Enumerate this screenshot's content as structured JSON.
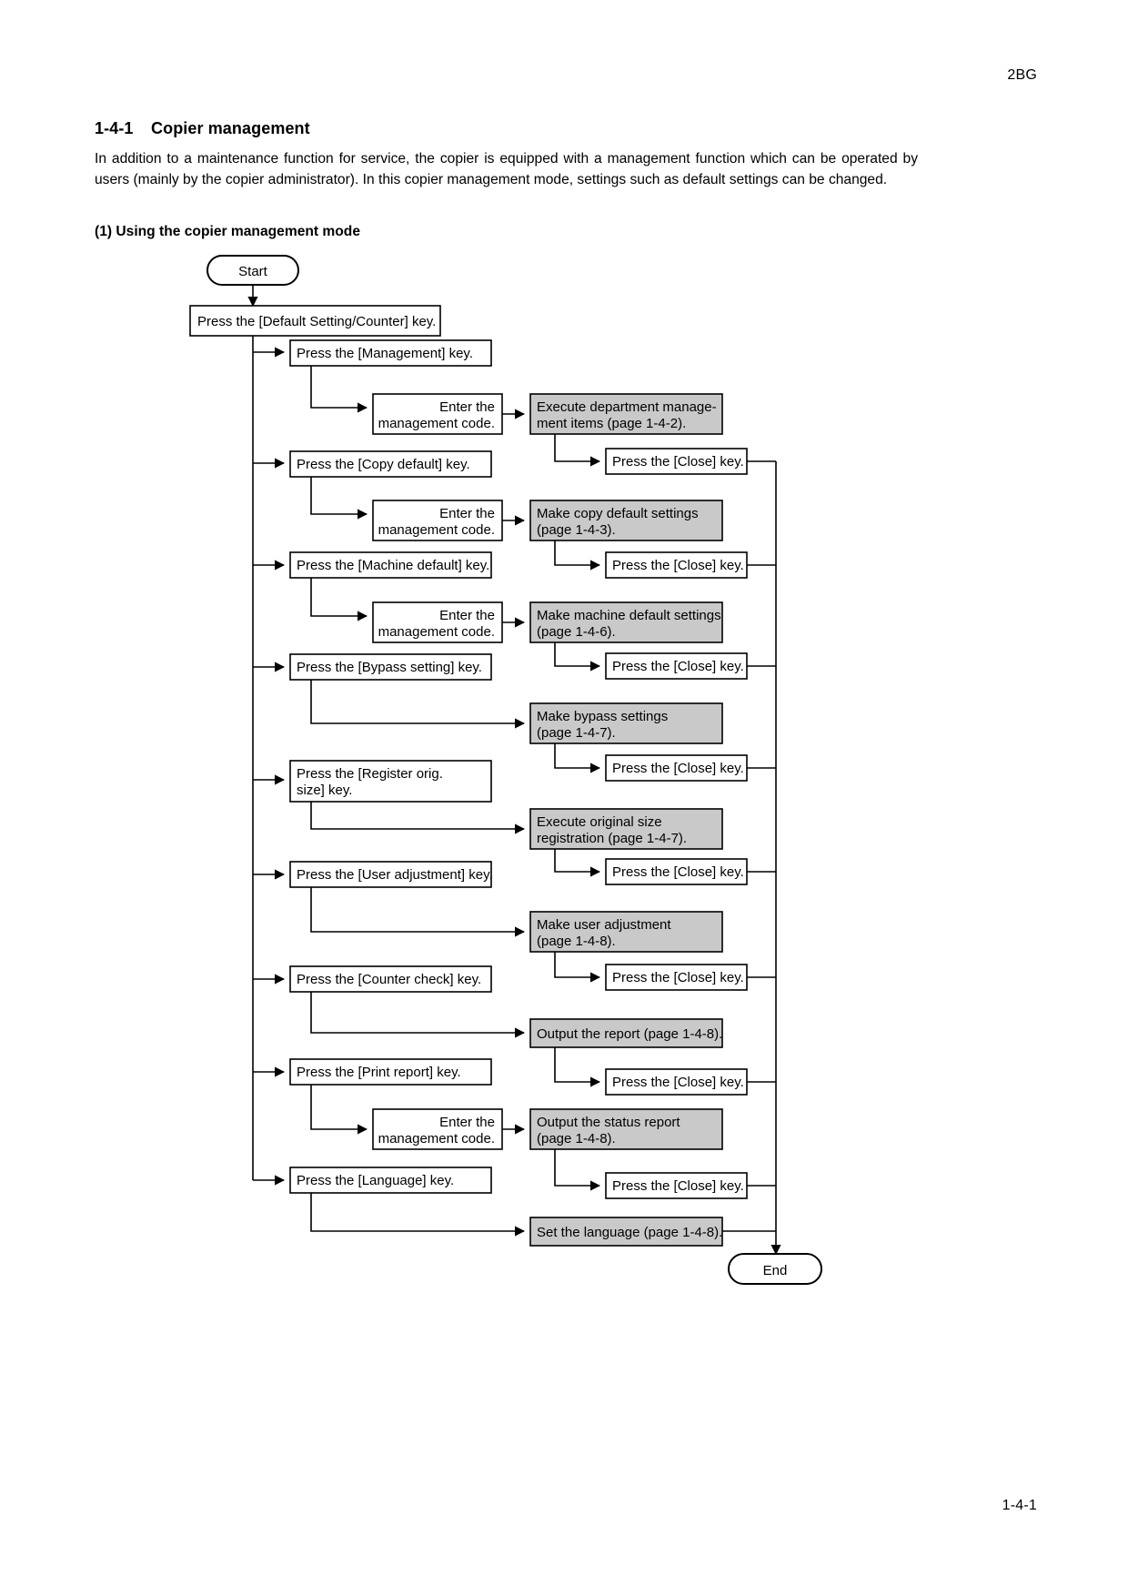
{
  "document": {
    "code": "2BG",
    "page_number": "1-4-1"
  },
  "section": {
    "number": "1-4-1",
    "title": "Copier management",
    "body": "In addition to a maintenance function for service, the copier is equipped with a management function which can be operated by users (mainly by the copier administrator). In this copier management mode, settings such as default settings can be changed.",
    "subsection_title": "(1) Using the copier management mode"
  },
  "flowchart": {
    "type": "flowchart",
    "start_label": "Start",
    "end_label": "End",
    "close_label": "Press the [Close] key.",
    "code_label_line1": "Enter the",
    "code_label_line2": "management code.",
    "entry": "Press the [Default Setting/Counter] key.",
    "branches": [
      {
        "key_label": "Press the [Management] key.",
        "requires_code": true,
        "action_line1": "Execute department manage-",
        "action_line2": "ment items (page 1-4-2).",
        "has_close": true
      },
      {
        "key_label": "Press the [Copy default] key.",
        "requires_code": true,
        "action_line1": "Make copy default settings",
        "action_line2": "(page 1-4-3).",
        "has_close": true
      },
      {
        "key_label": "Press the [Machine default] key.",
        "requires_code": true,
        "action_line1": "Make machine default settings",
        "action_line2": "(page 1-4-6).",
        "has_close": true
      },
      {
        "key_label": "Press the [Bypass setting] key.",
        "requires_code": false,
        "action_line1": "Make bypass settings",
        "action_line2": "(page 1-4-7).",
        "has_close": true
      },
      {
        "key_label_line1": "Press the [Register orig.",
        "key_label_line2": "size] key.",
        "requires_code": false,
        "action_line1": "Execute original size",
        "action_line2": "registration (page 1-4-7).",
        "has_close": true
      },
      {
        "key_label": "Press the [User adjustment] key.",
        "requires_code": false,
        "action_line1": "Make user adjustment",
        "action_line2": " (page 1-4-8).",
        "has_close": true
      },
      {
        "key_label": "Press the [Counter check] key.",
        "requires_code": false,
        "action_line1": "Output the report (page 1-4-8).",
        "action_line2": "",
        "has_close": true
      },
      {
        "key_label": "Press the [Print report] key.",
        "requires_code": true,
        "action_line1": "Output the status report",
        "action_line2": "(page 1-4-8).",
        "has_close": true
      },
      {
        "key_label": "Press the [Language] key.",
        "requires_code": false,
        "action_line1": "Set the language (page 1-4-8).",
        "action_line2": "",
        "has_close": false
      }
    ],
    "colors": {
      "shaded_fill": "#c9c9c9",
      "box_fill": "#ffffff",
      "stroke": "#000000"
    }
  }
}
